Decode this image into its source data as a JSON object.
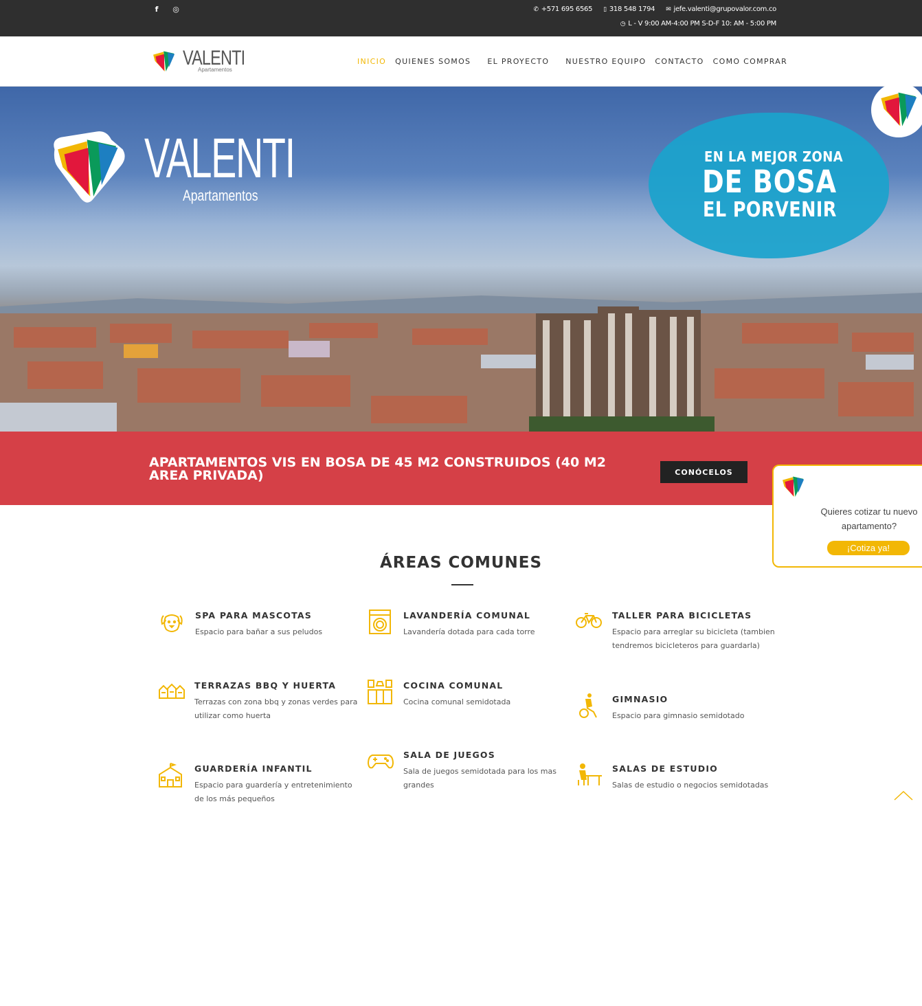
{
  "topbar": {
    "social": [
      {
        "icon": "facebook-icon",
        "glyph": "f"
      },
      {
        "icon": "instagram-icon",
        "glyph": "◎"
      }
    ],
    "phone": "+571 695 6565",
    "mobile": "318 548 1794",
    "email": "jefe.valenti@grupovalor.com.co",
    "hours": "L - V 9:00 AM-4:00 PM S-D-F 10: AM - 5:00 PM"
  },
  "header": {
    "brand_name": "VALENTI",
    "brand_sub": "Apartamentos",
    "nav": [
      {
        "label": "INICIO",
        "active": true
      },
      {
        "label": "QUIENES SOMOS",
        "active": false
      },
      {
        "label": "EL PROYECTO",
        "active": false
      },
      {
        "label": "NUESTRO EQUIPO",
        "active": false
      },
      {
        "label": "CONTACTO",
        "active": false
      },
      {
        "label": "COMO COMPRAR",
        "active": false
      }
    ]
  },
  "hero": {
    "title": "VALENTI",
    "subtitle": "Apartamentos",
    "bubble_line1": "EN LA MEJOR ZONA",
    "bubble_line2": "DE BOSA",
    "bubble_line3": "EL PORVENIR"
  },
  "band": {
    "text": "APARTAMENTOS VIS EN BOSA DE 45 M2 CONSTRUIDOS (40 M2 AREA PRIVADA)",
    "button": "CONÓCELOS"
  },
  "quote": {
    "text": "Quieres cotizar tu nuevo apartamento?",
    "button": "¡Cotiza ya!"
  },
  "areas": {
    "title": "ÁREAS COMUNES",
    "items": [
      {
        "title": "SPA PARA MASCOTAS",
        "desc": "Espacio para bañar a sus peludos",
        "icon": "dog-icon"
      },
      {
        "title": "LAVANDERÍA COMUNAL",
        "desc": "Lavandería dotada para cada torre",
        "icon": "washing-machine-icon"
      },
      {
        "title": "TALLER PARA BICICLETAS",
        "desc": "Espacio para arreglar su bicicleta (tambien tendremos bicicleteros para guardarla)",
        "icon": "bicycle-icon"
      },
      {
        "title": "TERRAZAS BBQ Y HUERTA",
        "desc": "Terrazas con zona bbq y zonas verdes para utilizar como huerta",
        "icon": "houses-icon"
      },
      {
        "title": "COCINA COMUNAL",
        "desc": "Cocina comunal semidotada",
        "icon": "kitchen-icon"
      },
      {
        "title": "GIMNASIO",
        "desc": "Espacio para gimnasio semidotado",
        "icon": "exercise-bike-icon"
      },
      {
        "title": "GUARDERÍA INFANTIL",
        "desc": "Espacio para guardería y entretenimiento de los más pequeños",
        "icon": "school-icon"
      },
      {
        "title": "SALA DE JUEGOS",
        "desc": "Sala de juegos semidotada para los mas grandes",
        "icon": "gamepad-icon"
      },
      {
        "title": "SALAS DE ESTUDIO",
        "desc": "Salas de estudio o negocios semidotadas",
        "icon": "study-desk-icon"
      }
    ]
  },
  "colors": {
    "accent": "#f2b705",
    "band": "#d54047",
    "topbar": "#2f2f2f",
    "bubble": "#1ba2cc"
  }
}
